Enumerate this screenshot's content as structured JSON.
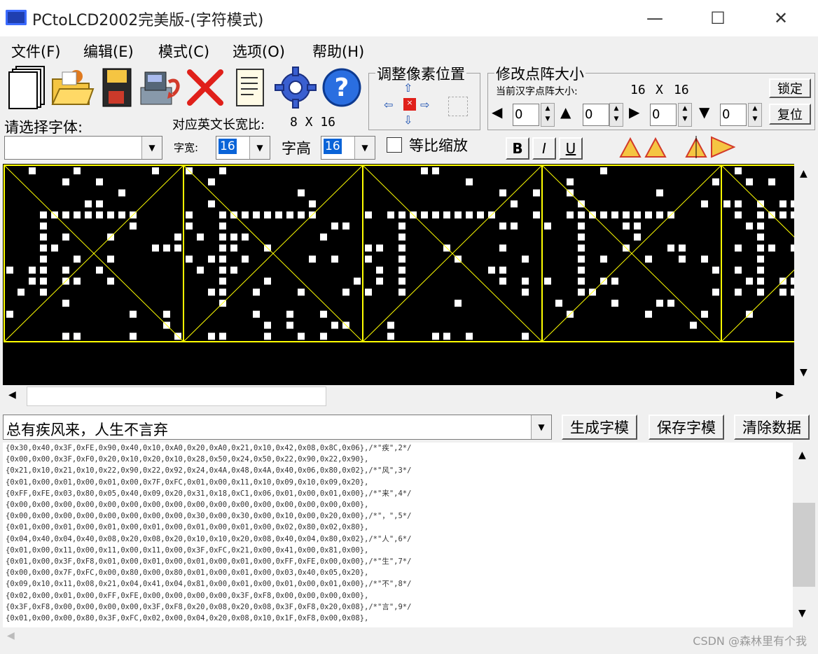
{
  "window": {
    "title": "PCtoLCD2002完美版-(字符模式)"
  },
  "menu": [
    "文件(F)",
    "编辑(E)",
    "模式(C)",
    "选项(O)",
    "帮助(H)"
  ],
  "toolbar": {
    "icons": [
      "new-file-icon",
      "open-folder-icon",
      "save-disk-icon",
      "save-as-icon",
      "delete-x-icon",
      "document-notes-icon",
      "settings-gear-icon",
      "help-question-icon"
    ]
  },
  "adjust_group": {
    "title": "调整像素位置"
  },
  "dot_size_group": {
    "title": "修改点阵大小",
    "current_label": "当前汉字点阵大小:",
    "current_w": "16",
    "current_x": "X",
    "current_h": "16",
    "lock_button": "锁定",
    "reset_button": "复位",
    "spinners": [
      "0",
      "0",
      "0",
      "0"
    ]
  },
  "font_section": {
    "select_font_label": "请选择字体:",
    "font_value": "",
    "english_ratio_label": "对应英文长宽比:",
    "english_ratio_value": "8 X 16",
    "width_label": "字宽:",
    "width_value": "16",
    "height_label": "字高",
    "height_value": "16",
    "proportional_label": "等比缩放",
    "proportional_checked": false
  },
  "format_buttons": {
    "bold": "B",
    "italic": "I",
    "underline": "U"
  },
  "input_row": {
    "text": "总有疾风来，人生不言弃",
    "generate_button": "生成字模",
    "save_button": "保存字模",
    "clear_button": "清除数据"
  },
  "output_lines": [
    "{0x30,0x40,0x3F,0xFE,0x90,0x40,0x10,0xA0,0x20,0xA0,0x21,0x10,0x42,0x08,0x8C,0x06},/*\"疾\",2*/",
    "{0x00,0x00,0x3F,0xF0,0x20,0x10,0x20,0x10,0x28,0x50,0x24,0x50,0x22,0x90,0x22,0x90},",
    "{0x21,0x10,0x21,0x10,0x22,0x90,0x22,0x92,0x24,0x4A,0x48,0x4A,0x40,0x06,0x80,0x02},/*\"风\",3*/",
    "{0x01,0x00,0x01,0x00,0x01,0x00,0x7F,0xFC,0x01,0x00,0x11,0x10,0x09,0x10,0x09,0x20},",
    "{0xFF,0xFE,0x03,0x80,0x05,0x40,0x09,0x20,0x31,0x18,0xC1,0x06,0x01,0x00,0x01,0x00},/*\"来\",4*/",
    "{0x00,0x00,0x00,0x00,0x00,0x00,0x00,0x00,0x00,0x00,0x00,0x00,0x00,0x00,0x00,0x00},",
    "{0x00,0x00,0x00,0x00,0x00,0x00,0x00,0x00,0x30,0x00,0x30,0x00,0x10,0x00,0x20,0x00},/*\"，\",5*/",
    "{0x01,0x00,0x01,0x00,0x01,0x00,0x01,0x00,0x01,0x00,0x01,0x00,0x02,0x80,0x02,0x80},",
    "{0x04,0x40,0x04,0x40,0x08,0x20,0x08,0x20,0x10,0x10,0x20,0x08,0x40,0x04,0x80,0x02},/*\"人\",6*/",
    "{0x01,0x00,0x11,0x00,0x11,0x00,0x11,0x00,0x3F,0xFC,0x21,0x00,0x41,0x00,0x81,0x00},",
    "{0x01,0x00,0x3F,0xF8,0x01,0x00,0x01,0x00,0x01,0x00,0x01,0x00,0xFF,0xFE,0x00,0x00},/*\"生\",7*/",
    "{0x00,0x00,0x7F,0xFC,0x00,0x80,0x00,0x80,0x01,0x00,0x01,0x00,0x03,0x40,0x05,0x20},",
    "{0x09,0x10,0x11,0x08,0x21,0x04,0x41,0x04,0x81,0x00,0x01,0x00,0x01,0x00,0x01,0x00},/*\"不\",8*/",
    "{0x02,0x00,0x01,0x00,0xFF,0xFE,0x00,0x00,0x00,0x00,0x3F,0xF8,0x00,0x00,0x00,0x00},",
    "{0x3F,0xF8,0x00,0x00,0x00,0x00,0x3F,0xF8,0x20,0x08,0x20,0x08,0x3F,0xF8,0x20,0x08},/*\"言\",9*/",
    "{0x01,0x00,0x00,0x80,0x3F,0xFC,0x02,0x00,0x04,0x20,0x08,0x10,0x1F,0xF8,0x00,0x08},"
  ],
  "watermark": "CSDN @森林里有个我",
  "colors": {
    "grid": "#ffff00",
    "canvas_bg": "#000000",
    "dot": "#ffffff",
    "selection": "#0a64d8"
  }
}
